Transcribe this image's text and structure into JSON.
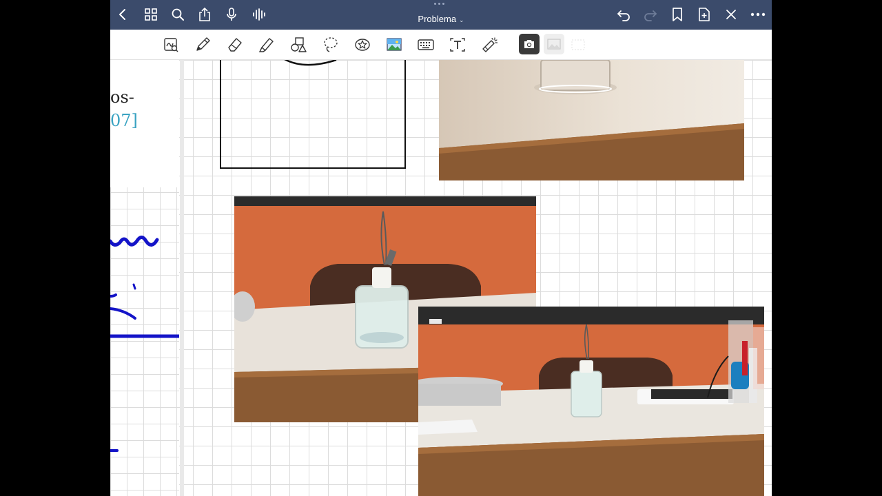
{
  "app": {
    "title": "Problema",
    "title_chevron": "⌄"
  },
  "topbar": {
    "left_icons": [
      "back-icon",
      "grid-icon",
      "search-icon",
      "share-icon",
      "microphone-icon",
      "audio-waveform-icon"
    ],
    "right_icons": [
      "undo-icon",
      "redo-icon",
      "bookmark-icon",
      "add-page-icon",
      "close-icon",
      "more-icon"
    ]
  },
  "toolbar": {
    "tools": [
      "scan-text-tool",
      "pen-tool",
      "eraser-tool",
      "highlighter-tool",
      "shapes-tool",
      "lasso-tool",
      "sticker-tool",
      "image-tool",
      "keyboard-tool",
      "text-tool",
      "laser-pointer-tool",
      "camera-tool",
      "image-select-tool"
    ],
    "active_tool": "camera-tool"
  },
  "page": {
    "pdf_text_line1": "os-",
    "pdf_text_line2": "07]"
  },
  "colors": {
    "topbar": "#3b4b6b",
    "ink_blue": "#1414c8",
    "pdf_link": "#3aa3c2",
    "wall": "#d56a3d",
    "bench": "#e8e2da",
    "wood": "#8a5a33"
  }
}
